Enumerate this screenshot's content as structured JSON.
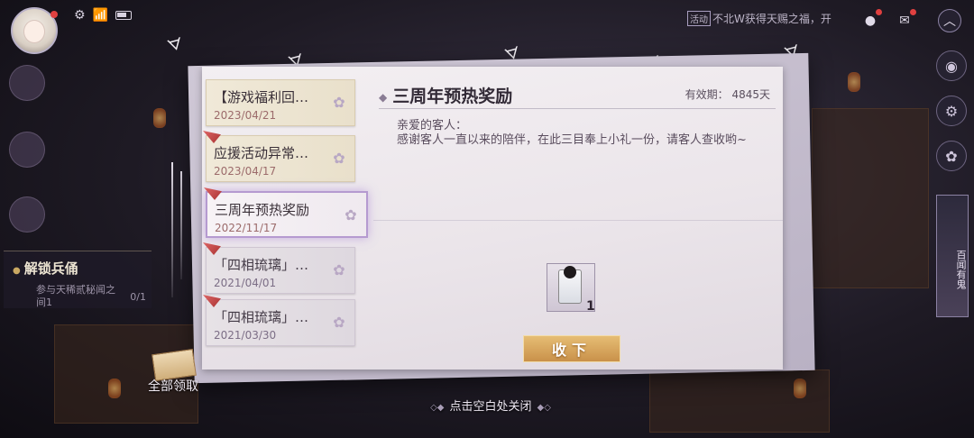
{
  "hud": {
    "ticker_tag": "活动",
    "ticker_text": "不北W获得天赐之福，开"
  },
  "quest": {
    "title": "解锁兵俑",
    "desc": "参与天稀贰秘闻之间1",
    "count": "0/1"
  },
  "right_banner": "百闻有鬼",
  "mail": {
    "items": [
      {
        "title": "【游戏福利回…",
        "date": "2023/04/21",
        "state": "unread"
      },
      {
        "title": "应援活动异常…",
        "date": "2023/04/17",
        "state": "unread"
      },
      {
        "title": "三周年预热奖励",
        "date": "2022/11/17",
        "state": "selected"
      },
      {
        "title": "「四相琉璃」…",
        "date": "2021/04/01",
        "state": "read"
      },
      {
        "title": "「四相琉璃」…",
        "date": "2021/03/30",
        "state": "read"
      }
    ]
  },
  "detail": {
    "title": "三周年预热奖励",
    "validity": "有效期： 4845天",
    "greeting": "亲爱的客人：",
    "body": "感谢客人一直以来的陪伴，在此三目奉上小礼一份，请客人查收哟~",
    "reward_count": "1",
    "collect_label": "收下"
  },
  "collect_all_label": "全部领取",
  "close_hint": "点击空白处关闭",
  "colors": {
    "accent_gold": "#c9914a",
    "selected_glow": "#b59ad0",
    "date_red": "#9c6b6b"
  }
}
